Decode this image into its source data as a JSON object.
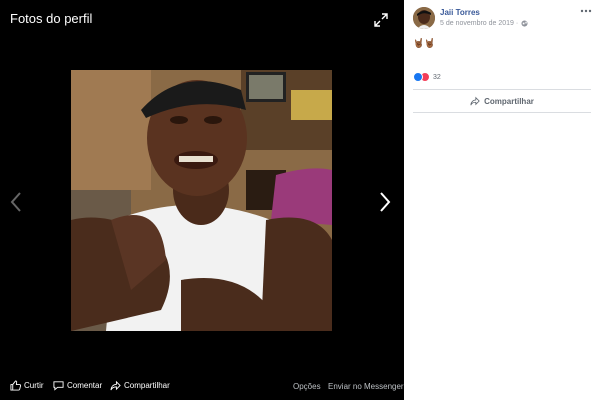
{
  "viewer": {
    "title": "Fotos do perfil",
    "footer": {
      "like_label": "Curtir",
      "comment_label": "Comentar",
      "share_label": "Compartilhar",
      "options_label": "Opções",
      "messenger_label": "Enviar no Messenger"
    }
  },
  "post": {
    "author": "Jaii Torres",
    "timestamp": "5 de novembro de 2019 ·",
    "text": "🤘🏾🤘🏾",
    "reaction_count": "32",
    "share_label": "Compartilhar"
  },
  "colors": {
    "viewer_bg": "#000000",
    "author_link": "#385898",
    "like_blue": "#1877f2",
    "love_red": "#f33e58"
  }
}
